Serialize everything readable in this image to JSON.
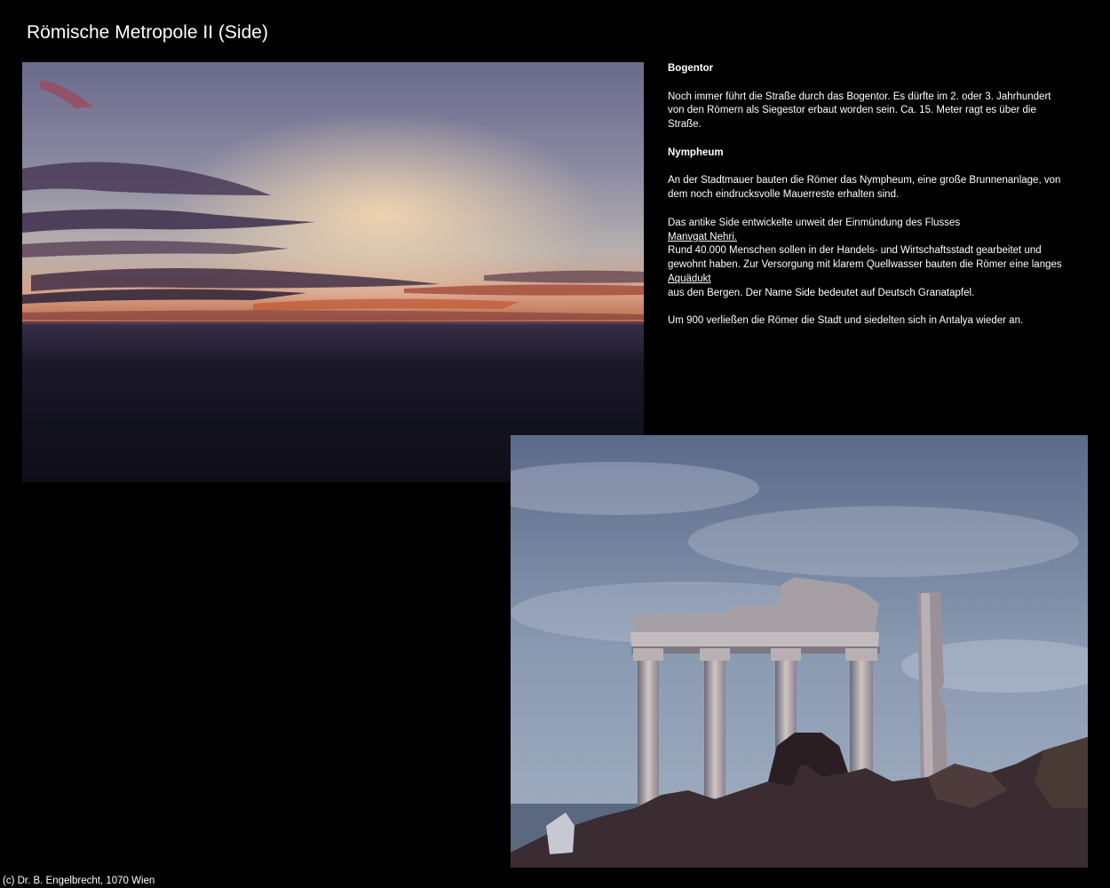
{
  "page": {
    "title": "Römische Metropole II (Side)"
  },
  "photos": {
    "sunset": {
      "name": "sunset-over-sea-photo"
    },
    "temple": {
      "name": "apollo-temple-ruins-photo"
    }
  },
  "content": {
    "heading_bogentor": "Bogentor",
    "bogentor_text": "Noch immer führt die Straße durch das Bogentor. Es dürfte im 2. oder 3. Jahrhundert von den Römern als Siegestor erbaut worden sein. Ca. 15. Meter ragt es über die Straße.",
    "heading_nympheum": "Nympheum",
    "nympheum_text": "An der Stadtmauer bauten die Römer das Nympheum, eine große Brunnenanlage, von dem noch eindrucksvolle Mauerreste erhalten sind.",
    "side_intro": "Das antike Side entwickelte unweit der Einmündung des Flusses",
    "link_manavgat": "Manvgat Nehri.",
    "side_middle": "Rund 40.000 Menschen sollen in der Handels- und Wirtschaftsstadt gearbeitet und gewohnt haben. Zur Versorgung mit klarem Quellwasser bauten die Römer eine langes",
    "link_aquaedukt": "Aquädukt",
    "side_end": "aus den Bergen. Der Name Side bedeutet auf Deutsch Granatapfel.",
    "closing_text": "Um 900 verließen die Römer die Stadt und siedelten sich in Antalya wieder an."
  },
  "footer": {
    "copyright": "(c) Dr. B. Engelbrecht, 1070 Wien"
  },
  "colors": {
    "background": "#000000",
    "text": "#ffffff"
  }
}
